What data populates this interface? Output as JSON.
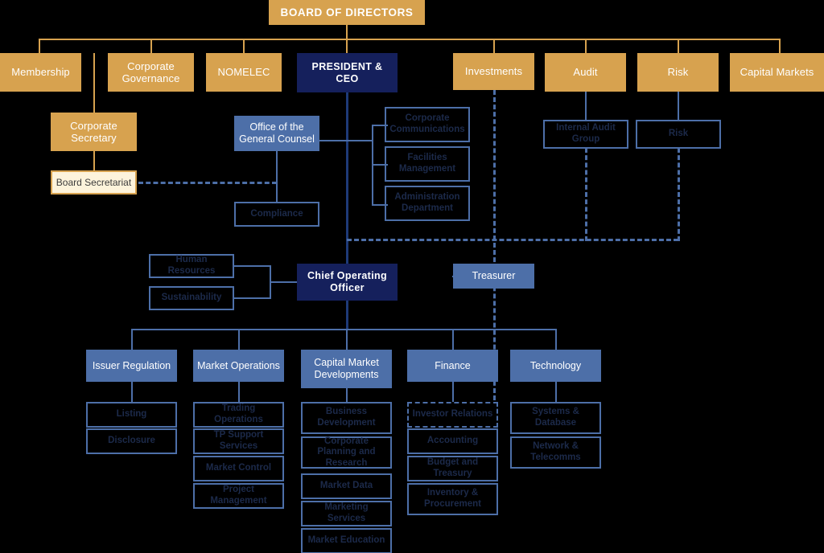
{
  "chart": {
    "type": "org-chart",
    "title": "Organizational Structure",
    "colors": {
      "gold": "#d7a24f",
      "gold_pale": "#fdf3db",
      "navy": "#15205c",
      "blue": "#4d6fa8",
      "line_navy": "#1e3a78",
      "background": "#000000"
    }
  },
  "board": {
    "label": "BOARD OF DIRECTORS"
  },
  "committees": [
    {
      "label": "Membership"
    },
    {
      "label": "Corporate Governance"
    },
    {
      "label": "NOMELEC"
    },
    {
      "label": "Investments"
    },
    {
      "label": "Audit"
    },
    {
      "label": "Risk"
    },
    {
      "label": "Capital Markets"
    }
  ],
  "executive": {
    "president": "PRESIDENT & CEO",
    "coo": "Chief Operating Officer",
    "treasurer": "Treasurer"
  },
  "corporate_secretary": {
    "label": "Corporate Secretary",
    "child": "Board Secretariat"
  },
  "general_counsel": {
    "label": "Office of the General Counsel",
    "child": "Compliance"
  },
  "president_units": [
    {
      "label": "Corporate Communications"
    },
    {
      "label": "Facilities Management"
    },
    {
      "label": "Administration Department"
    }
  ],
  "committee_units": [
    {
      "label": "Internal Audit Group",
      "parent": "Audit"
    },
    {
      "label": "Risk",
      "parent": "Risk"
    }
  ],
  "coo_staff": [
    {
      "label": "Human Resources"
    },
    {
      "label": "Sustainability"
    }
  ],
  "divisions": [
    {
      "label": "Issuer Regulation",
      "units": [
        {
          "label": "Listing",
          "style": "solid"
        },
        {
          "label": "Disclosure",
          "style": "solid"
        }
      ]
    },
    {
      "label": "Market Operations",
      "units": [
        {
          "label": "Trading Operations",
          "style": "solid"
        },
        {
          "label": "TP Support Services",
          "style": "solid"
        },
        {
          "label": "Market Control",
          "style": "solid"
        },
        {
          "label": "Project Management",
          "style": "solid"
        }
      ]
    },
    {
      "label": "Capital Market Developments",
      "units": [
        {
          "label": "Business Development",
          "style": "solid"
        },
        {
          "label": "Corporate Planning and Research",
          "style": "solid"
        },
        {
          "label": "Market Data",
          "style": "solid"
        },
        {
          "label": "Marketing Services",
          "style": "solid"
        },
        {
          "label": "Market Education",
          "style": "solid"
        }
      ]
    },
    {
      "label": "Finance",
      "units": [
        {
          "label": "Investor Relations",
          "style": "dashed"
        },
        {
          "label": "Accounting",
          "style": "solid"
        },
        {
          "label": "Budget and Treasury",
          "style": "solid"
        },
        {
          "label": "Inventory & Procurement",
          "style": "solid"
        }
      ]
    },
    {
      "label": "Technology",
      "units": [
        {
          "label": "Systems & Database",
          "style": "solid"
        },
        {
          "label": "Network & Telecomms",
          "style": "solid"
        }
      ]
    }
  ]
}
